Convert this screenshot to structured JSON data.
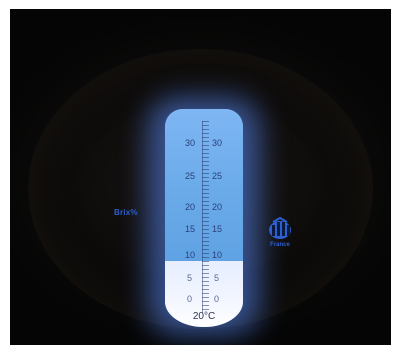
{
  "scale": {
    "ticks_left": [
      "30",
      "25",
      "20",
      "15",
      "10",
      "5",
      "0"
    ],
    "ticks_right": [
      "30",
      "25",
      "20",
      "15",
      "10",
      "5",
      "0"
    ],
    "temperature": "20°C",
    "reading_value": 10
  },
  "unit_label": "Brix%",
  "brand": {
    "text": "France",
    "icon": "logo-icon"
  },
  "colors": {
    "background": "#050505",
    "upper_field": "#6aaae9",
    "lower_field": "#f3f6ff",
    "label_blue": "#2c5fd0"
  }
}
